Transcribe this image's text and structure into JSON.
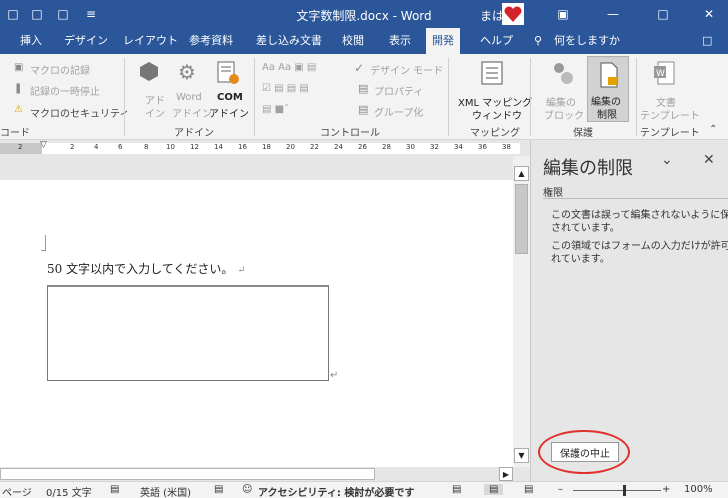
{
  "titlebar": {
    "title": "文字数制限.docx  -  Word",
    "user": "まは",
    "qat": [
      "print-preview-icon",
      "open-icon",
      "new-icon",
      "customize-icon"
    ],
    "window_buttons": [
      "ribbon-display-icon",
      "minimize-icon",
      "maximize-icon",
      "close-icon"
    ]
  },
  "tabs": {
    "items": [
      "挿入",
      "デザイン",
      "レイアウト",
      "参考資料",
      "差し込み文書",
      "校閲",
      "表示",
      "開発",
      "ヘルプ"
    ],
    "active": "開発",
    "tellme": "何をしますか"
  },
  "ribbon": {
    "code": {
      "macro_record": "マクロの記録",
      "pause": "記録の一時停止",
      "security": "マクロのセキュリティ",
      "label": "コード"
    },
    "addins": {
      "addin": [
        "アド",
        "イン"
      ],
      "word_addin": [
        "Word",
        "アドイン"
      ],
      "com_addin": [
        "COM",
        "アドイン"
      ],
      "label": "アドイン"
    },
    "controls": {
      "design_mode": "デザイン モード",
      "properties": "プロパティ",
      "group": "グループ化",
      "label": "コントロール"
    },
    "mapping": {
      "xml": [
        "XML マッピング",
        "ウィンドウ"
      ],
      "label": "マッピング"
    },
    "protect": {
      "block": [
        "編集の",
        "ブロック"
      ],
      "restrict": [
        "編集の",
        "制限"
      ],
      "label": "保護"
    },
    "templates": {
      "doc_template": [
        "文書",
        "テンプレート"
      ],
      "label": "テンプレート"
    }
  },
  "ruler": {
    "ticks": [
      "2",
      "2",
      "4",
      "6",
      "8",
      "10",
      "12",
      "14",
      "16",
      "18",
      "20",
      "22",
      "24",
      "26",
      "28",
      "30",
      "32",
      "34",
      "36",
      "38"
    ]
  },
  "document": {
    "prompt": "50 文字以内で入力してください。",
    "para_mark": "↵"
  },
  "pane": {
    "title": "編集の制限",
    "section": "権限",
    "lines": [
      "この文書は誤って編集されないように保護",
      "されています。",
      "この領域ではフォームの入力だけが許可さ",
      "れています。"
    ],
    "stop_button": "保護の中止"
  },
  "status": {
    "page": "ページ",
    "words": "0/15 文字",
    "language": "英語 (米国)",
    "accessibility": "アクセシビリティ: 検討が必要です",
    "zoom": "100%"
  },
  "colors": {
    "brand": "#2b579a",
    "highlight": "#e0302a"
  }
}
